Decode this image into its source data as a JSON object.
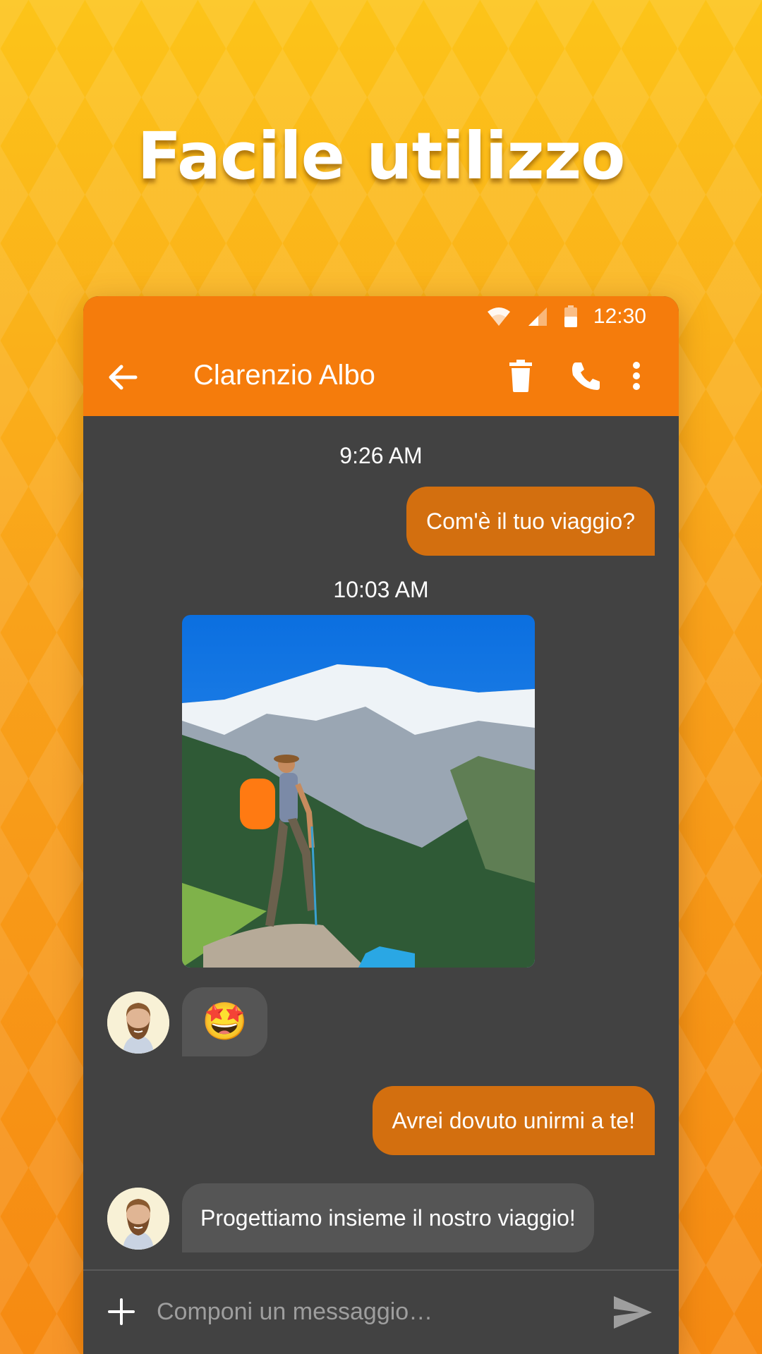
{
  "headline": "Facile utilizzo",
  "statusbar": {
    "time": "12:30"
  },
  "appbar": {
    "contact_name": "Clarenzio Albo"
  },
  "messages": [
    {
      "type": "timestamp",
      "text": "9:26 AM"
    },
    {
      "type": "outgoing",
      "text": "Com'è il tuo viaggio?"
    },
    {
      "type": "timestamp",
      "text": "10:03 AM"
    },
    {
      "type": "incoming-image",
      "description": "mountain-hiker-photo"
    },
    {
      "type": "incoming",
      "text": "🤩"
    },
    {
      "type": "outgoing",
      "text": "Avrei dovuto unirmi a te!"
    },
    {
      "type": "incoming",
      "text": "Progettiamo insieme il nostro viaggio!"
    }
  ],
  "composer": {
    "placeholder": "Componi un messaggio…"
  },
  "colors": {
    "accent": "#f57c0c",
    "outgoing_bubble": "#d36f0f",
    "incoming_bubble": "#555555",
    "chat_bg": "#424242"
  }
}
